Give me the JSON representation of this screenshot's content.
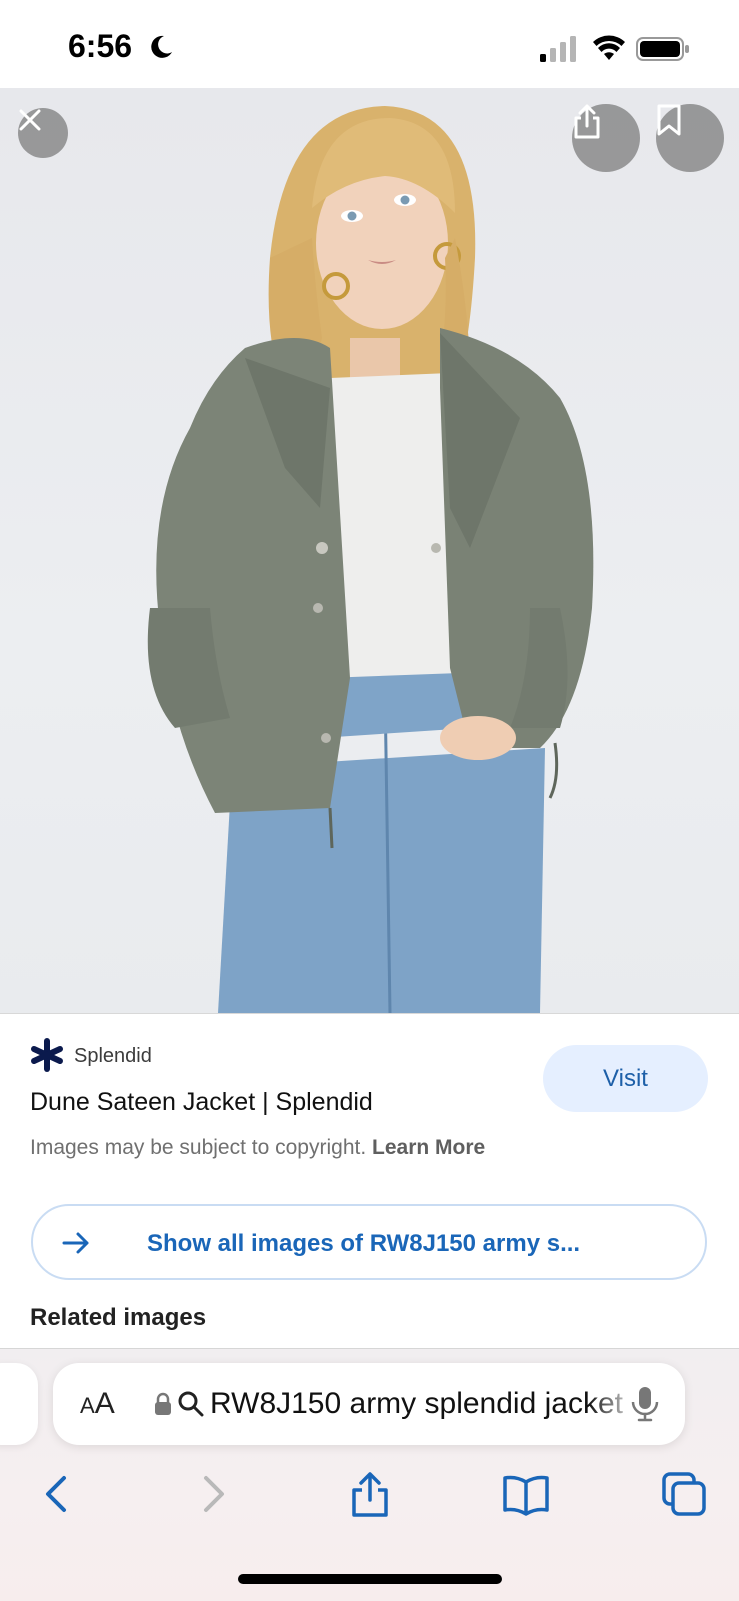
{
  "status_bar": {
    "time": "6:56",
    "icons": [
      "moon-icon",
      "cellular-signal-icon",
      "wifi-icon",
      "battery-icon"
    ]
  },
  "image_viewer": {
    "icons": [
      "close-icon",
      "share-icon",
      "bookmark-icon"
    ]
  },
  "result": {
    "source_name": "Splendid",
    "title": "Dune Sateen Jacket | Splendid",
    "copyright_text": "Images may be subject to copyright.",
    "learn_more": "Learn More",
    "visit_label": "Visit",
    "show_all_label": "Show all images of RW8J150 army s...",
    "related_heading": "Related images"
  },
  "address_bar": {
    "text_size_label_small": "A",
    "text_size_label_large": "A",
    "url": "RW8J150 army splendid jacket",
    "icons": [
      "lock-icon",
      "search-icon",
      "microphone-icon"
    ]
  },
  "toolbar": {
    "icons": [
      "back-icon",
      "forward-icon",
      "share-icon",
      "bookmarks-icon",
      "tabs-icon"
    ]
  },
  "colors": {
    "accent": "#1a66b8",
    "visit_bg": "#e5efff",
    "brand_logo": "#0b1a4d"
  }
}
